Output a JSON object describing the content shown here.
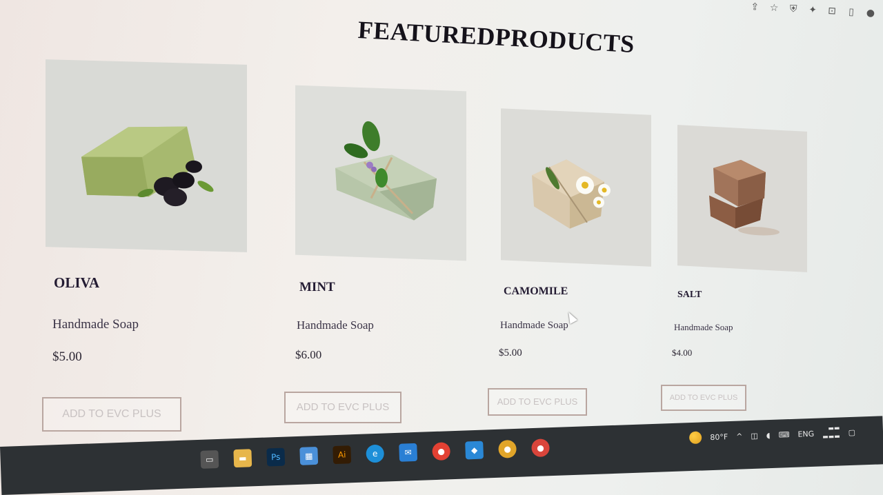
{
  "heading": "FEATUREDPRODUCTS",
  "products": [
    {
      "name": "OLIVA",
      "subtitle": "Handmade Soap",
      "price": "$5.00",
      "button_label": "ADD TO EVC PLUS",
      "image": "olive-soap-image"
    },
    {
      "name": "MINT",
      "subtitle": "Handmade Soap",
      "price": "$6.00",
      "button_label": "ADD TO EVC PLUS",
      "image": "mint-soap-image"
    },
    {
      "name": "CAMOMILE",
      "subtitle": "Handmade Soap",
      "price": "$5.00",
      "button_label": "ADD TO EVC PLUS",
      "image": "camomile-soap-image"
    },
    {
      "name": "SALT",
      "subtitle": "Handmade Soap",
      "price": "$4.00",
      "button_label": "ADD TO EVC PLUS",
      "image": "salt-soap-image"
    }
  ],
  "taskbar": {
    "apps": [
      "Ps",
      "Ai"
    ],
    "weather": "80°F",
    "language": "ENG"
  },
  "colors": {
    "heading": "#15121a",
    "button_border": "#b9a6a0",
    "button_text": "#c8c2c2",
    "taskbar": "#2d3134"
  }
}
